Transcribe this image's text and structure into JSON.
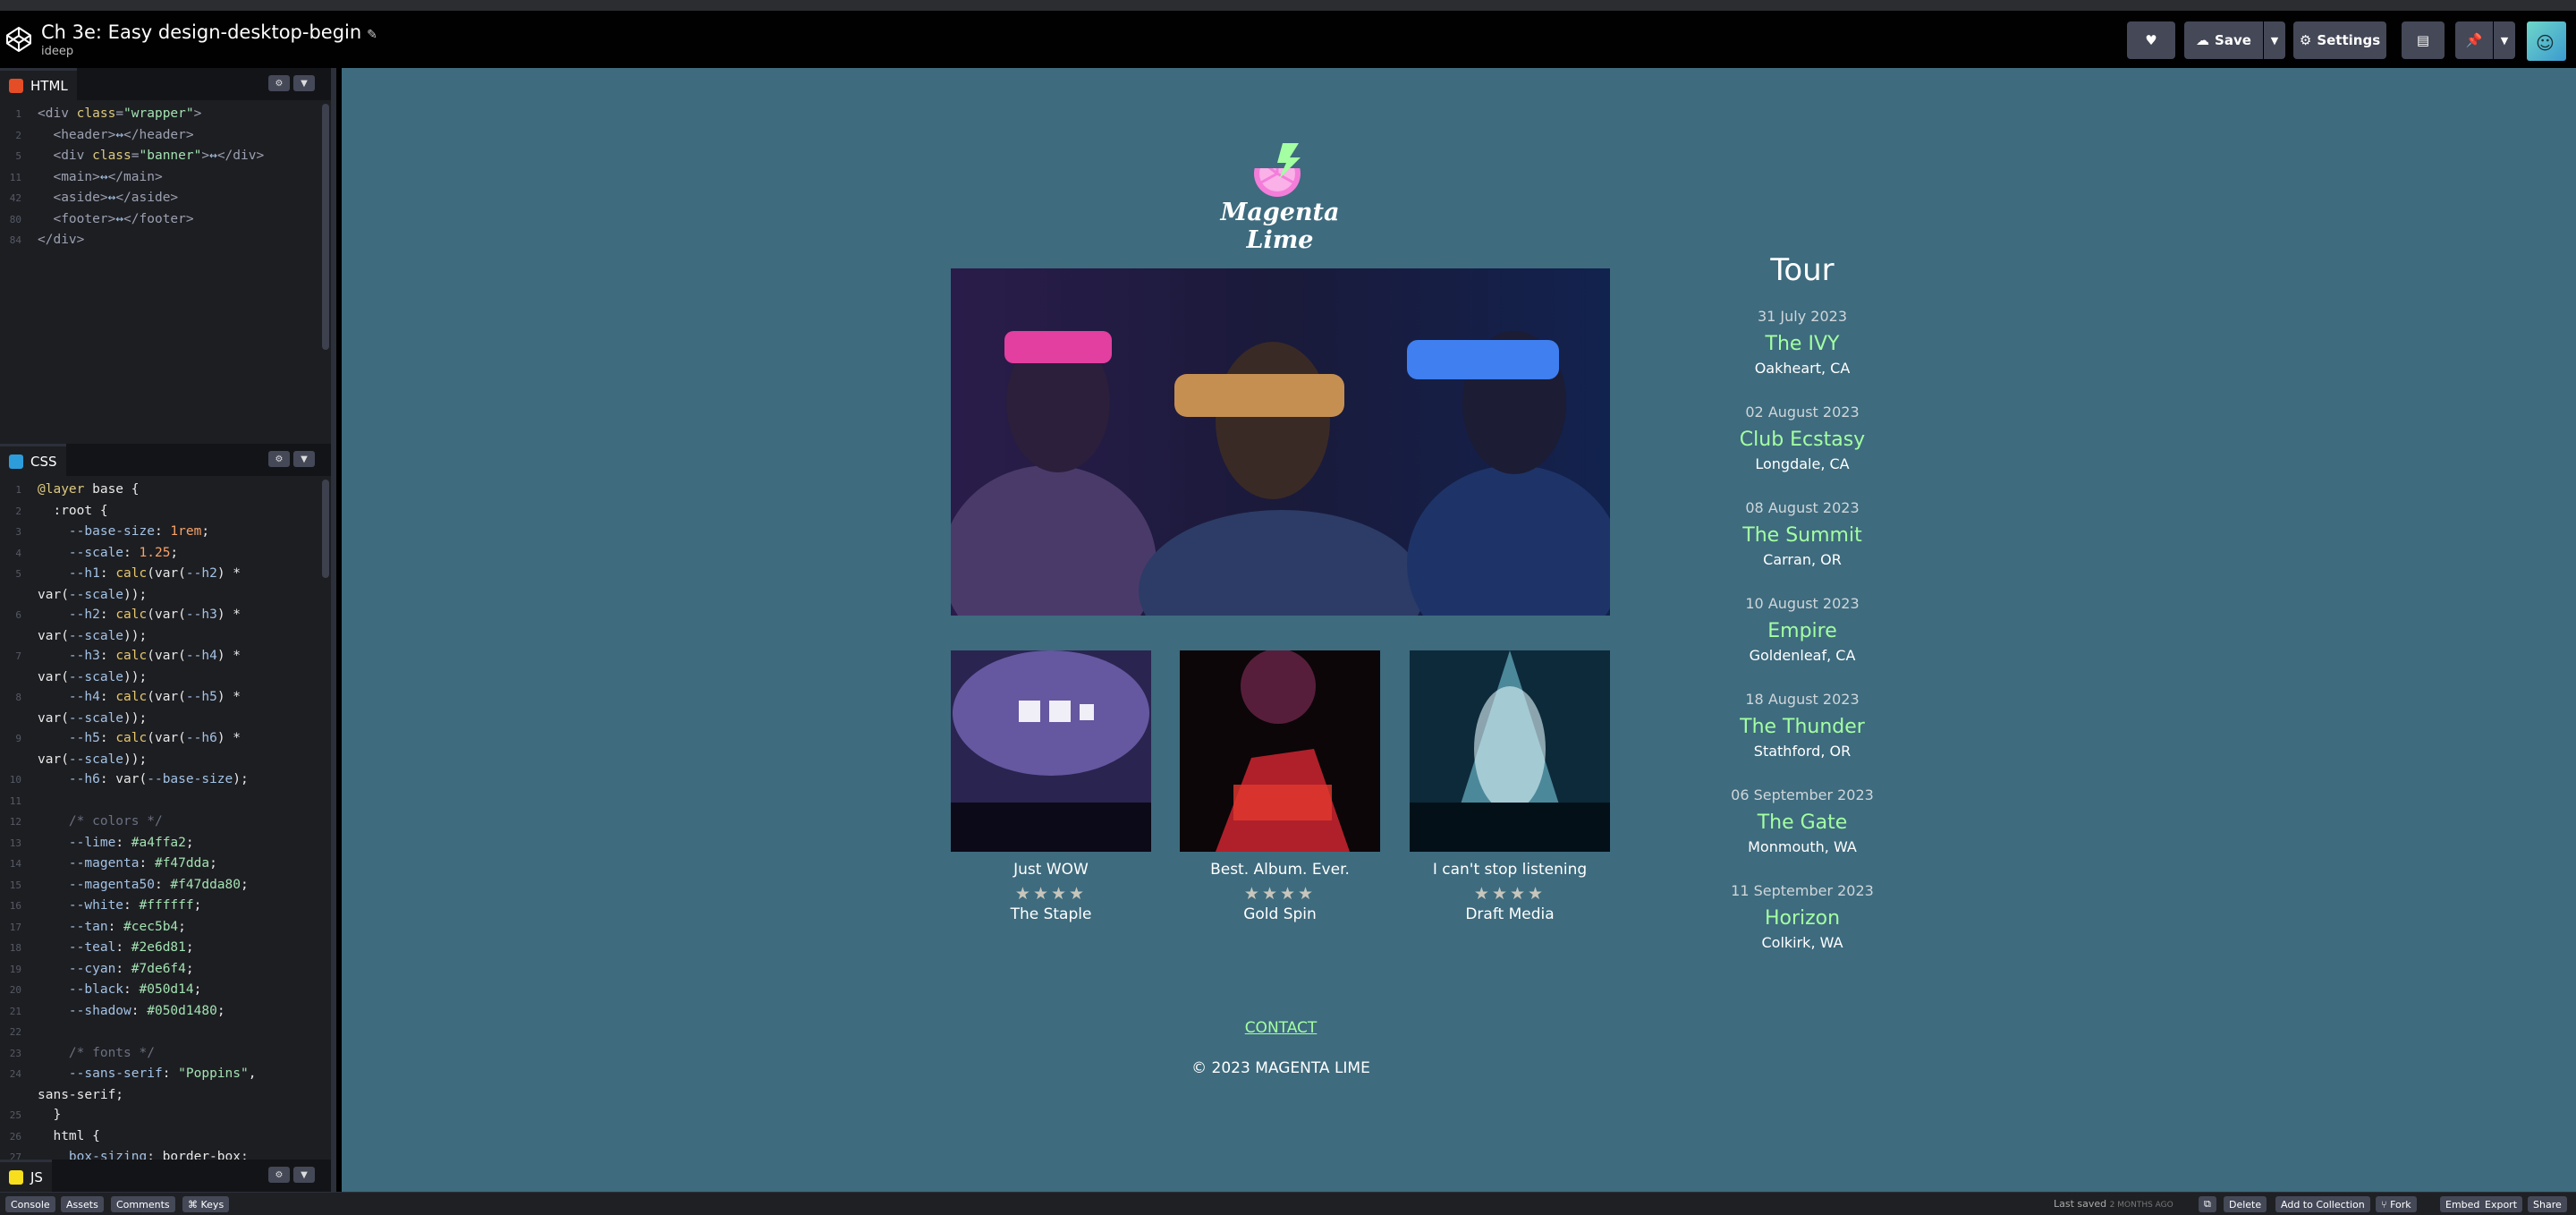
{
  "header": {
    "title": "Ch 3e: Easy design-desktop-begin",
    "user": "ideep",
    "save_label": "Save",
    "settings_label": "Settings"
  },
  "editors": {
    "html": {
      "label": "HTML",
      "badge_color": "#e44d26",
      "lines": [
        {
          "n": "1",
          "parts": [
            [
              "c-tag",
              "<div "
            ],
            [
              "c-attr",
              "class"
            ],
            [
              "c-tag",
              "="
            ],
            [
              "c-str",
              "\"wrapper\""
            ],
            [
              "c-tag",
              ">"
            ]
          ]
        },
        {
          "n": "2",
          "parts": [
            [
              "c-tag",
              "  <header>"
            ],
            [
              "c-var",
              "↔"
            ],
            [
              "c-tag",
              "</header>"
            ]
          ]
        },
        {
          "n": "5",
          "parts": [
            [
              "c-tag",
              "  <div "
            ],
            [
              "c-attr",
              "class"
            ],
            [
              "c-tag",
              "="
            ],
            [
              "c-str",
              "\"banner\""
            ],
            [
              "c-tag",
              ">"
            ],
            [
              "c-var",
              "↔"
            ],
            [
              "c-tag",
              "</div>"
            ]
          ]
        },
        {
          "n": "11",
          "parts": [
            [
              "c-tag",
              "  <main>"
            ],
            [
              "c-var",
              "↔"
            ],
            [
              "c-tag",
              "</main>"
            ]
          ]
        },
        {
          "n": "42",
          "parts": [
            [
              "c-tag",
              "  <aside>"
            ],
            [
              "c-var",
              "↔"
            ],
            [
              "c-tag",
              "</aside>"
            ]
          ]
        },
        {
          "n": "80",
          "parts": [
            [
              "c-tag",
              "  <footer>"
            ],
            [
              "c-var",
              "↔"
            ],
            [
              "c-tag",
              "</footer>"
            ]
          ]
        },
        {
          "n": "84",
          "parts": [
            [
              "c-tag",
              "</div>"
            ]
          ]
        }
      ]
    },
    "css": {
      "label": "CSS",
      "badge_color": "#2d9cdb",
      "lines": [
        {
          "n": "1",
          "parts": [
            [
              "c-kw",
              "@layer "
            ],
            [
              "c-sel",
              "base {"
            ]
          ]
        },
        {
          "n": "2",
          "parts": [
            [
              "c-sel",
              "  :root {"
            ]
          ]
        },
        {
          "n": "3",
          "parts": [
            [
              "c-var",
              "    --base-size"
            ],
            [
              "c-sel",
              ": "
            ],
            [
              "c-num",
              "1rem"
            ],
            [
              "c-sel",
              ";"
            ]
          ]
        },
        {
          "n": "4",
          "parts": [
            [
              "c-var",
              "    --scale"
            ],
            [
              "c-sel",
              ": "
            ],
            [
              "c-num",
              "1.25"
            ],
            [
              "c-sel",
              ";"
            ]
          ]
        },
        {
          "n": "5",
          "parts": [
            [
              "c-var",
              "    --h1"
            ],
            [
              "c-sel",
              ": "
            ],
            [
              "c-fn",
              "calc"
            ],
            [
              "c-sel",
              "(var("
            ],
            [
              "c-var",
              "--h2"
            ],
            [
              "c-sel",
              ") *"
            ]
          ]
        },
        {
          "n": "",
          "parts": [
            [
              "c-sel",
              "var("
            ],
            [
              "c-var",
              "--scale"
            ],
            [
              "c-sel",
              "));"
            ]
          ]
        },
        {
          "n": "6",
          "parts": [
            [
              "c-var",
              "    --h2"
            ],
            [
              "c-sel",
              ": "
            ],
            [
              "c-fn",
              "calc"
            ],
            [
              "c-sel",
              "(var("
            ],
            [
              "c-var",
              "--h3"
            ],
            [
              "c-sel",
              ") *"
            ]
          ]
        },
        {
          "n": "",
          "parts": [
            [
              "c-sel",
              "var("
            ],
            [
              "c-var",
              "--scale"
            ],
            [
              "c-sel",
              "));"
            ]
          ]
        },
        {
          "n": "7",
          "parts": [
            [
              "c-var",
              "    --h3"
            ],
            [
              "c-sel",
              ": "
            ],
            [
              "c-fn",
              "calc"
            ],
            [
              "c-sel",
              "(var("
            ],
            [
              "c-var",
              "--h4"
            ],
            [
              "c-sel",
              ") *"
            ]
          ]
        },
        {
          "n": "",
          "parts": [
            [
              "c-sel",
              "var("
            ],
            [
              "c-var",
              "--scale"
            ],
            [
              "c-sel",
              "));"
            ]
          ]
        },
        {
          "n": "8",
          "parts": [
            [
              "c-var",
              "    --h4"
            ],
            [
              "c-sel",
              ": "
            ],
            [
              "c-fn",
              "calc"
            ],
            [
              "c-sel",
              "(var("
            ],
            [
              "c-var",
              "--h5"
            ],
            [
              "c-sel",
              ") *"
            ]
          ]
        },
        {
          "n": "",
          "parts": [
            [
              "c-sel",
              "var("
            ],
            [
              "c-var",
              "--scale"
            ],
            [
              "c-sel",
              "));"
            ]
          ]
        },
        {
          "n": "9",
          "parts": [
            [
              "c-var",
              "    --h5"
            ],
            [
              "c-sel",
              ": "
            ],
            [
              "c-fn",
              "calc"
            ],
            [
              "c-sel",
              "(var("
            ],
            [
              "c-var",
              "--h6"
            ],
            [
              "c-sel",
              ") *"
            ]
          ]
        },
        {
          "n": "",
          "parts": [
            [
              "c-sel",
              "var("
            ],
            [
              "c-var",
              "--scale"
            ],
            [
              "c-sel",
              "));"
            ]
          ]
        },
        {
          "n": "10",
          "parts": [
            [
              "c-var",
              "    --h6"
            ],
            [
              "c-sel",
              ": var("
            ],
            [
              "c-var",
              "--base-size"
            ],
            [
              "c-sel",
              ");"
            ]
          ]
        },
        {
          "n": "11",
          "parts": [
            [
              "c-sel",
              ""
            ]
          ]
        },
        {
          "n": "12",
          "parts": [
            [
              "c-com",
              "    /* colors */"
            ]
          ]
        },
        {
          "n": "13",
          "parts": [
            [
              "c-var",
              "    --lime"
            ],
            [
              "c-sel",
              ": "
            ],
            [
              "c-str",
              "#a4ffa2"
            ],
            [
              "c-sel",
              ";"
            ]
          ]
        },
        {
          "n": "14",
          "parts": [
            [
              "c-var",
              "    --magenta"
            ],
            [
              "c-sel",
              ": "
            ],
            [
              "c-str",
              "#f47dda"
            ],
            [
              "c-sel",
              ";"
            ]
          ]
        },
        {
          "n": "15",
          "parts": [
            [
              "c-var",
              "    --magenta50"
            ],
            [
              "c-sel",
              ": "
            ],
            [
              "c-str",
              "#f47dda80"
            ],
            [
              "c-sel",
              ";"
            ]
          ]
        },
        {
          "n": "16",
          "parts": [
            [
              "c-var",
              "    --white"
            ],
            [
              "c-sel",
              ": "
            ],
            [
              "c-str",
              "#ffffff"
            ],
            [
              "c-sel",
              ";"
            ]
          ]
        },
        {
          "n": "17",
          "parts": [
            [
              "c-var",
              "    --tan"
            ],
            [
              "c-sel",
              ": "
            ],
            [
              "c-str",
              "#cec5b4"
            ],
            [
              "c-sel",
              ";"
            ]
          ]
        },
        {
          "n": "18",
          "parts": [
            [
              "c-var",
              "    --teal"
            ],
            [
              "c-sel",
              ": "
            ],
            [
              "c-str",
              "#2e6d81"
            ],
            [
              "c-sel",
              ";"
            ]
          ]
        },
        {
          "n": "19",
          "parts": [
            [
              "c-var",
              "    --cyan"
            ],
            [
              "c-sel",
              ": "
            ],
            [
              "c-str",
              "#7de6f4"
            ],
            [
              "c-sel",
              ";"
            ]
          ]
        },
        {
          "n": "20",
          "parts": [
            [
              "c-var",
              "    --black"
            ],
            [
              "c-sel",
              ": "
            ],
            [
              "c-str",
              "#050d14"
            ],
            [
              "c-sel",
              ";"
            ]
          ]
        },
        {
          "n": "21",
          "parts": [
            [
              "c-var",
              "    --shadow"
            ],
            [
              "c-sel",
              ": "
            ],
            [
              "c-str",
              "#050d1480"
            ],
            [
              "c-sel",
              ";"
            ]
          ]
        },
        {
          "n": "22",
          "parts": [
            [
              "c-sel",
              ""
            ]
          ]
        },
        {
          "n": "23",
          "parts": [
            [
              "c-com",
              "    /* fonts */"
            ]
          ]
        },
        {
          "n": "24",
          "parts": [
            [
              "c-var",
              "    --sans-serif"
            ],
            [
              "c-sel",
              ": "
            ],
            [
              "c-str",
              "\"Poppins\""
            ],
            [
              "c-sel",
              ","
            ]
          ]
        },
        {
          "n": "",
          "parts": [
            [
              "c-sel",
              "sans-serif;"
            ]
          ]
        },
        {
          "n": "25",
          "parts": [
            [
              "c-sel",
              "  }"
            ]
          ]
        },
        {
          "n": "26",
          "parts": [
            [
              "c-sel",
              "  html {"
            ]
          ]
        },
        {
          "n": "27",
          "parts": [
            [
              "c-var",
              "    box-sizing"
            ],
            [
              "c-sel",
              ": border-box;"
            ]
          ]
        },
        {
          "n": "",
          "parts": [
            [
              "c-sel",
              "  }"
            ]
          ]
        }
      ]
    },
    "js": {
      "label": "JS",
      "badge_color": "#f7df1e"
    }
  },
  "preview": {
    "brand": "Magenta Lime",
    "albums": [
      {
        "caption": "Just WOW",
        "rating": 4,
        "artist": "The Staple"
      },
      {
        "caption": "Best. Album. Ever.",
        "rating": 4,
        "artist": "Gold Spin"
      },
      {
        "caption": "I can't stop listening",
        "rating": 4,
        "artist": "Draft Media"
      }
    ],
    "tour": {
      "heading": "Tour",
      "gigs": [
        {
          "date": "31 July 2023",
          "venue": "The IVY",
          "city": "Oakheart, CA"
        },
        {
          "date": "02 August 2023",
          "venue": "Club Ecstasy",
          "city": "Longdale, CA"
        },
        {
          "date": "08 August 2023",
          "venue": "The Summit",
          "city": "Carran, OR"
        },
        {
          "date": "10 August 2023",
          "venue": "Empire",
          "city": "Goldenleaf, CA"
        },
        {
          "date": "18 August 2023",
          "venue": "The Thunder",
          "city": "Stathford, OR"
        },
        {
          "date": "06 September 2023",
          "venue": "The Gate",
          "city": "Monmouth, WA"
        },
        {
          "date": "11 September 2023",
          "venue": "Horizon",
          "city": "Colkirk, WA"
        }
      ]
    },
    "contact": "CONTACT",
    "copyright": "© 2023 MAGENTA LIME",
    "colors": {
      "lime": "#a4ffa2",
      "magenta": "#f47dda",
      "teal": "#3e6b7e"
    }
  },
  "footer": {
    "left_buttons": [
      "Console",
      "Assets",
      "Comments",
      "⌘ Keys"
    ],
    "last_saved": "Last saved",
    "last_saved_when": "2 MONTHS AGO",
    "right_buttons": [
      "Delete",
      "Add to Collection",
      "Fork",
      "Embed",
      "Export",
      "Share"
    ]
  }
}
